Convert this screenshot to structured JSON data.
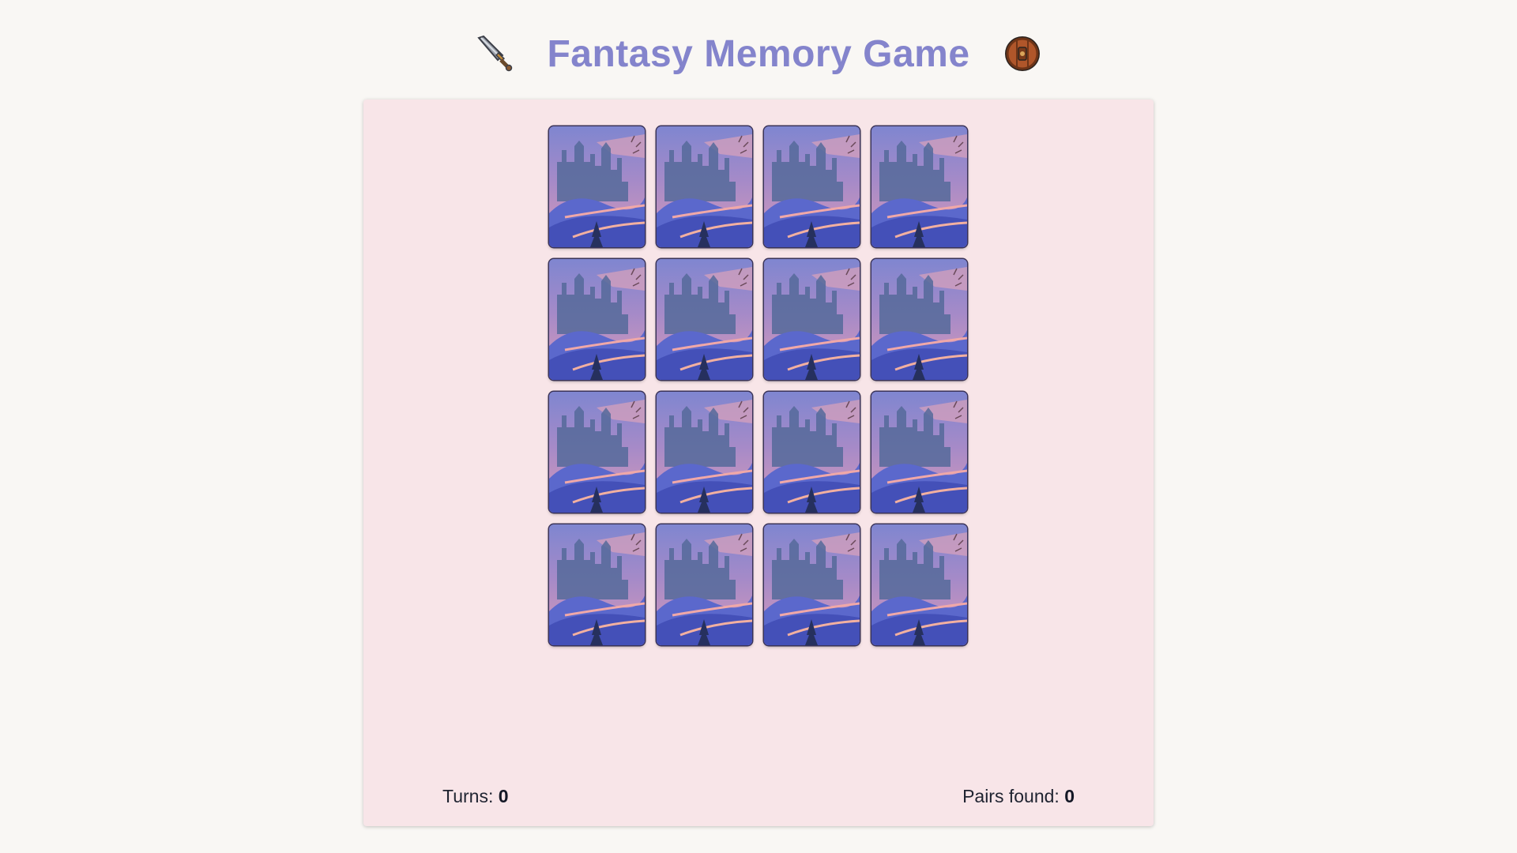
{
  "header": {
    "title": "Fantasy Memory Game",
    "left_icon": "sword-icon",
    "right_icon": "shield-icon"
  },
  "board": {
    "columns": 4,
    "rows": 4,
    "card_back": "castle-landscape-card-back",
    "cards": [
      {
        "state": "face-down"
      },
      {
        "state": "face-down"
      },
      {
        "state": "face-down"
      },
      {
        "state": "face-down"
      },
      {
        "state": "face-down"
      },
      {
        "state": "face-down"
      },
      {
        "state": "face-down"
      },
      {
        "state": "face-down"
      },
      {
        "state": "face-down"
      },
      {
        "state": "face-down"
      },
      {
        "state": "face-down"
      },
      {
        "state": "face-down"
      },
      {
        "state": "face-down"
      },
      {
        "state": "face-down"
      },
      {
        "state": "face-down"
      },
      {
        "state": "face-down"
      }
    ]
  },
  "stats": {
    "turns_label": "Turns:",
    "turns_value": "0",
    "pairs_label": "Pairs found:",
    "pairs_value": "0"
  },
  "colors": {
    "background": "#f9f7f4",
    "panel": "#f8e5e8",
    "title": "#8484cc",
    "card_sky": "#8a82c8",
    "card_hill": "#4f5ac4"
  }
}
